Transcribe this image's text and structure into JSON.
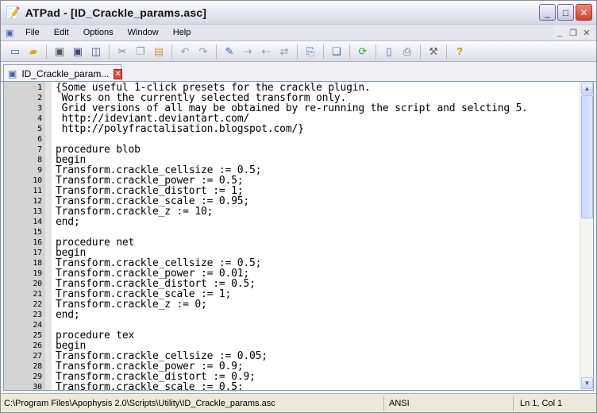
{
  "window": {
    "title": "ATPad - [ID_Crackle_params.asc]",
    "minimize": "_",
    "maximize": "□",
    "close": "✕"
  },
  "menu": {
    "items": [
      "File",
      "Edit",
      "Options",
      "Window",
      "Help"
    ],
    "mdi": [
      "_",
      "❐",
      "✕"
    ]
  },
  "toolbar": {
    "icons": [
      "new-icon",
      "open-icon",
      "save-icon",
      "save-as-icon",
      "save-all-icon",
      "cut-icon",
      "copy-icon",
      "paste-icon",
      "undo-icon",
      "redo-icon",
      "find-icon",
      "find-next-icon",
      "find-prev-icon",
      "replace-icon",
      "attach-icon",
      "windows-icon",
      "refresh-icon",
      "page-setup-icon",
      "print-icon",
      "tools-icon",
      "help-icon"
    ]
  },
  "tab": {
    "label": "ID_Crackle_param...",
    "close": "✕"
  },
  "editor": {
    "lines": [
      "{Some useful 1-click presets for the crackle plugin.",
      " Works on the currently selected transform only.",
      " Grid versions of all may be obtained by re-running the script and selcting 5.",
      " http://ideviant.deviantart.com/",
      " http://polyfractalisation.blogspot.com/}",
      "",
      "procedure blob",
      "begin",
      "Transform.crackle_cellsize := 0.5;",
      "Transform.crackle_power := 0.5;",
      "Transform.crackle_distort := 1;",
      "Transform.crackle_scale := 0.95;",
      "Transform.crackle_z := 10;",
      "end;",
      "",
      "procedure net",
      "begin",
      "Transform.crackle_cellsize := 0.5;",
      "Transform.crackle_power := 0.01;",
      "Transform.crackle_distort := 0.5;",
      "Transform.crackle_scale := 1;",
      "Transform.crackle_z := 0;",
      "end;",
      "",
      "procedure tex",
      "begin",
      "Transform.crackle_cellsize := 0.05;",
      "Transform.crackle_power := 0.9;",
      "Transform.crackle_distort := 0.9;",
      "Transform.crackle_scale := 0.5;"
    ]
  },
  "status": {
    "path": "C:\\Program Files\\Apophysis 2.0\\Scripts\\Utility\\ID_Crackle_params.asc",
    "encoding": "ANSI",
    "position": "Ln 1, Col 1"
  }
}
